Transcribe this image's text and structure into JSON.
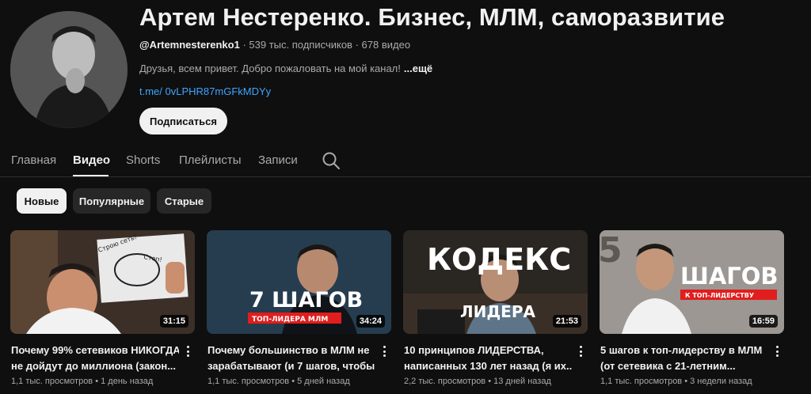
{
  "channel": {
    "name": "Артем Нестеренко. Бизнес, МЛМ, саморазвитие",
    "handle": "@Artemnesterenko1",
    "subscribers": "539 тыс. подписчиков",
    "video_count": "678 видео",
    "separator": " · ",
    "description": "Друзья, всем привет. Добро пожаловать на мой канал!",
    "more_label": "...ещё",
    "link": "t.me/ 0vLPHR87mGFkMDYy",
    "subscribe_label": "Подписаться"
  },
  "tabs": [
    {
      "label": "Главная"
    },
    {
      "label": "Видео"
    },
    {
      "label": "Shorts"
    },
    {
      "label": "Плейлисты"
    },
    {
      "label": "Записи"
    }
  ],
  "active_tab": "Видео",
  "chips": [
    {
      "label": "Новые"
    },
    {
      "label": "Популярные"
    },
    {
      "label": "Старые"
    }
  ],
  "active_chip": "Новые",
  "videos": [
    {
      "title_line1": "Почему 99% сетевиков НИКОГДА",
      "title_line2": "не дойдут до миллиона (закон...",
      "duration": "31:15",
      "views": "1,1 тыс. просмотров",
      "age": "1 день назад",
      "thumb_text": [
        "Строю сеть!",
        "Стоп!"
      ]
    },
    {
      "title_line1": "Почему большинство в МЛМ не",
      "title_line2": "зарабатывают (и 7 шагов, чтобы...",
      "duration": "34:24",
      "views": "1,1 тыс. просмотров",
      "age": "5 дней назад",
      "thumb_text": [
        "7 ШАГОВ",
        "ТОП-ЛИДЕРА МЛМ"
      ]
    },
    {
      "title_line1": "10 принципов ЛИДЕРСТВА,",
      "title_line2": "написанных 130 лет назад (я их...",
      "duration": "21:53",
      "views": "2,2 тыс. просмотров",
      "age": "13 дней назад",
      "thumb_text": [
        "КОДЕКС",
        "ЛИДЕРА"
      ]
    },
    {
      "title_line1": "5 шагов к топ-лидерству в МЛМ",
      "title_line2": "(от сетевика с 21-летним...",
      "duration": "16:59",
      "views": "1,1 тыс. просмотров",
      "age": "3 недели назад",
      "thumb_text": [
        "5",
        "ШАГОВ",
        "К ТОП-ЛИДЕРСТВУ"
      ]
    }
  ],
  "colors": {
    "background": "#0f0f0f",
    "link": "#3ea6ff",
    "secondary_text": "#aaaaaa",
    "chip_bg": "#272727"
  }
}
